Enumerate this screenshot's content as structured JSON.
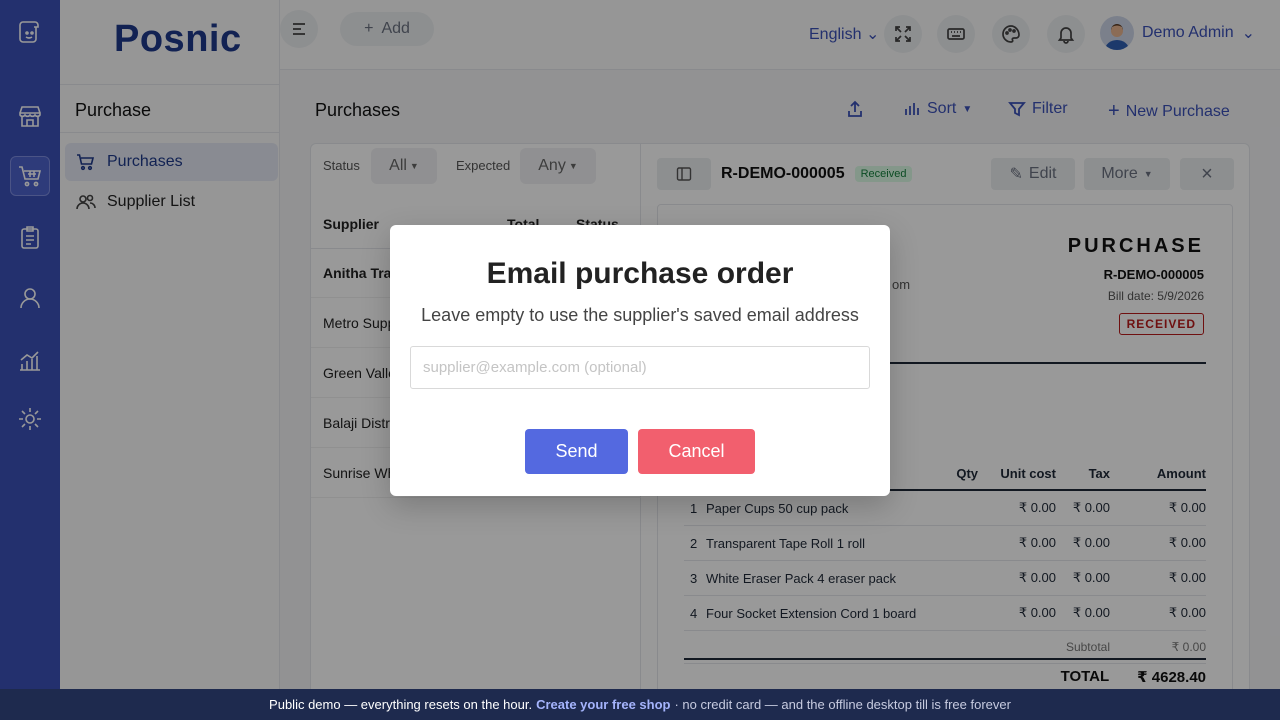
{
  "brand": {
    "logo": "Posnic"
  },
  "topbar": {
    "add_label": "Add",
    "language": "English",
    "user_name": "Demo Admin"
  },
  "sidebar": {
    "section_title": "Purchase",
    "items": [
      {
        "label": "Purchases",
        "active": true
      },
      {
        "label": "Supplier List",
        "active": false
      }
    ]
  },
  "main": {
    "title": "Purchases",
    "actions": {
      "sort": "Sort",
      "filter": "Filter",
      "new": "New Purchase"
    }
  },
  "list": {
    "filters": [
      {
        "label": "Status",
        "value": "All"
      },
      {
        "label": "Expected",
        "value": "Any"
      }
    ],
    "columns": [
      "Supplier",
      "Total",
      "Status"
    ],
    "rows": [
      "Anitha Trad",
      "Metro Supp",
      "Green Valle",
      "Balaji Distri",
      "Sunrise Wh"
    ]
  },
  "detail": {
    "id": "R-DEMO-000005",
    "status_badge": "Received",
    "edit_label": "Edit",
    "more_label": "More",
    "close_icon": "×",
    "doc": {
      "heading": "PURCHASE",
      "number": "R-DEMO-000005",
      "bill_date": "Bill date: 5/9/2026",
      "stamp": "RECEIVED",
      "email_fragment": "om",
      "columns": [
        "Qty",
        "Unit cost",
        "Tax",
        "Amount"
      ],
      "items": [
        {
          "no": "1",
          "name": "Paper Cups 50 cup pack",
          "unit": "₹ 0.00",
          "tax": "₹ 0.00",
          "amount": "₹ 0.00"
        },
        {
          "no": "2",
          "name": "Transparent Tape Roll 1 roll",
          "unit": "₹ 0.00",
          "tax": "₹ 0.00",
          "amount": "₹ 0.00"
        },
        {
          "no": "3",
          "name": "White Eraser Pack 4 eraser pack",
          "unit": "₹ 0.00",
          "tax": "₹ 0.00",
          "amount": "₹ 0.00"
        },
        {
          "no": "4",
          "name": "Four Socket Extension Cord 1 board",
          "unit": "₹ 0.00",
          "tax": "₹ 0.00",
          "amount": "₹ 0.00"
        }
      ],
      "subtotal_label": "Subtotal",
      "subtotal_value": "₹ 0.00",
      "total_label": "TOTAL",
      "total_value": "₹ 4628.40"
    }
  },
  "modal": {
    "title": "Email purchase order",
    "subtitle": "Leave empty to use the supplier's saved email address",
    "input_placeholder": "supplier@example.com (optional)",
    "input_value": "",
    "send_label": "Send",
    "cancel_label": "Cancel",
    "send_color": "#5469e0",
    "cancel_color": "#f25f6e"
  },
  "footer": {
    "lead": "Public demo — everything resets on the hour.",
    "link": "Create your free shop",
    "tail": "· no credit card — and the offline desktop till is free forever"
  }
}
